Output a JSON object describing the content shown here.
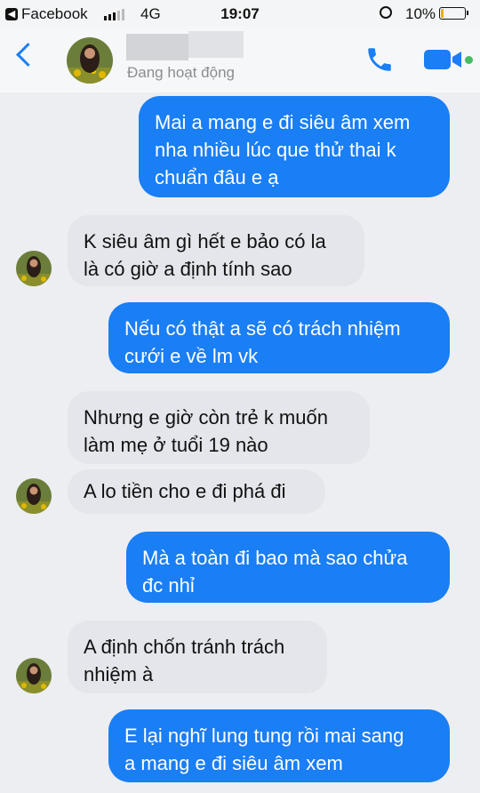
{
  "status_bar": {
    "carrier_app": "Facebook",
    "network": "4G",
    "time": "19:07",
    "battery": "10%",
    "signal_bars": 3,
    "signal_bars_total": 5,
    "battery_level": 0.1
  },
  "header": {
    "status": "Đang hoạt động",
    "icons": [
      "back-chevron-icon",
      "phone-icon",
      "video-camera-icon"
    ]
  },
  "messages": [
    {
      "side": "sent",
      "text": "Mai a mang e đi siêu âm xem\nnha nhiều lúc que thử thai k\nchuẩn đâu e ạ"
    },
    {
      "side": "received",
      "text": "K siêu âm gì hết e bảo có la\nlà có giờ a định tính sao"
    },
    {
      "side": "sent",
      "text": "Nếu có thật a sẽ có trách nhiệm\ncưới e về lm vk"
    },
    {
      "side": "received",
      "text": "Nhưng e giờ còn trẻ k muốn\nlàm mẹ ở tuổi 19 nào"
    },
    {
      "side": "received",
      "text": "A lo tiền cho e đi phá đi"
    },
    {
      "side": "sent",
      "text": "Mà a toàn đi bao mà sao chửa\nđc nhỉ"
    },
    {
      "side": "received",
      "text": "A định chốn tránh trách\nnhiệm à"
    },
    {
      "side": "sent",
      "text": "E lại nghĩ lung tung rồi mai sang\na mang e đi siêu âm xem"
    }
  ],
  "colors": {
    "sent_bubble": "#1a7ef5",
    "received_bubble": "#e4e6eb",
    "accent": "#1a7ef5",
    "active_dot": "#45bd62"
  }
}
